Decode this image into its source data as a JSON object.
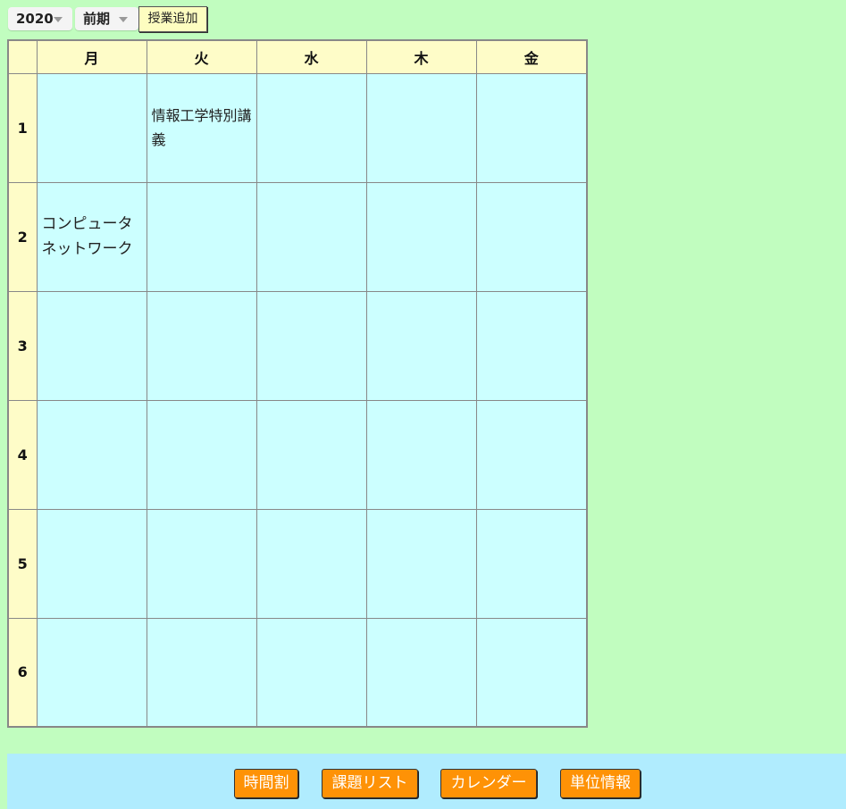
{
  "toolbar": {
    "year": "2020",
    "term": "前期",
    "add_label": "授業追加"
  },
  "timetable": {
    "days": [
      "月",
      "火",
      "水",
      "木",
      "金"
    ],
    "periods": [
      "1",
      "2",
      "3",
      "4",
      "5",
      "6"
    ],
    "courses": {
      "p1_tue": "情報工学特別講義",
      "p2_mon": "コンピュータネットワーク"
    }
  },
  "nav": {
    "timetable": "時間割",
    "assignments": "課題リスト",
    "calendar": "カレンダー",
    "credits": "単位情報"
  },
  "colors": {
    "page_bg": "#c1fdbf",
    "header_bg": "#fefcc8",
    "cell_bg": "#ccffff",
    "footer_bg": "#b0ecfe",
    "nav_button_bg": "#fe9206"
  }
}
